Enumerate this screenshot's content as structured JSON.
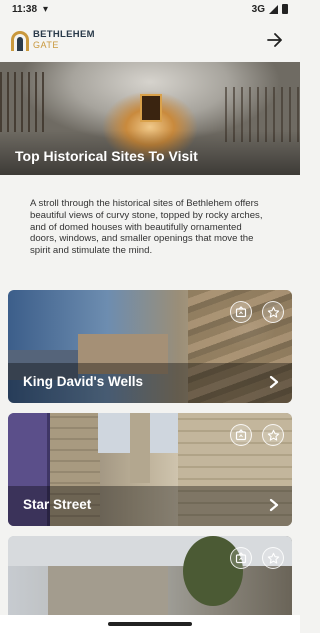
{
  "status_bar": {
    "time": "11:38",
    "network": "3G"
  },
  "header": {
    "brand_line1": "BETHLEHEM",
    "brand_line2": "GATE"
  },
  "hero": {
    "title": "Top Historical Sites To Visit"
  },
  "intro": {
    "text": "A stroll through the historical sites of Bethlehem offers beautiful views of curvy stone, topped by rocky arches, and of domed houses with beautifully ornamented doors, windows, and smaller openings that move the spirit and stimulate the mind."
  },
  "cards": [
    {
      "name": "King David's Wells"
    },
    {
      "name": "Star Street"
    },
    {
      "name": ""
    }
  ],
  "colors": {
    "accent_gold": "#c9983d",
    "brand_dark": "#2a3a4a"
  },
  "icons": {
    "back": "arrow-right-icon",
    "gallery": "photo-frame-icon",
    "favorite": "star-icon",
    "open": "chevron-right-icon"
  }
}
